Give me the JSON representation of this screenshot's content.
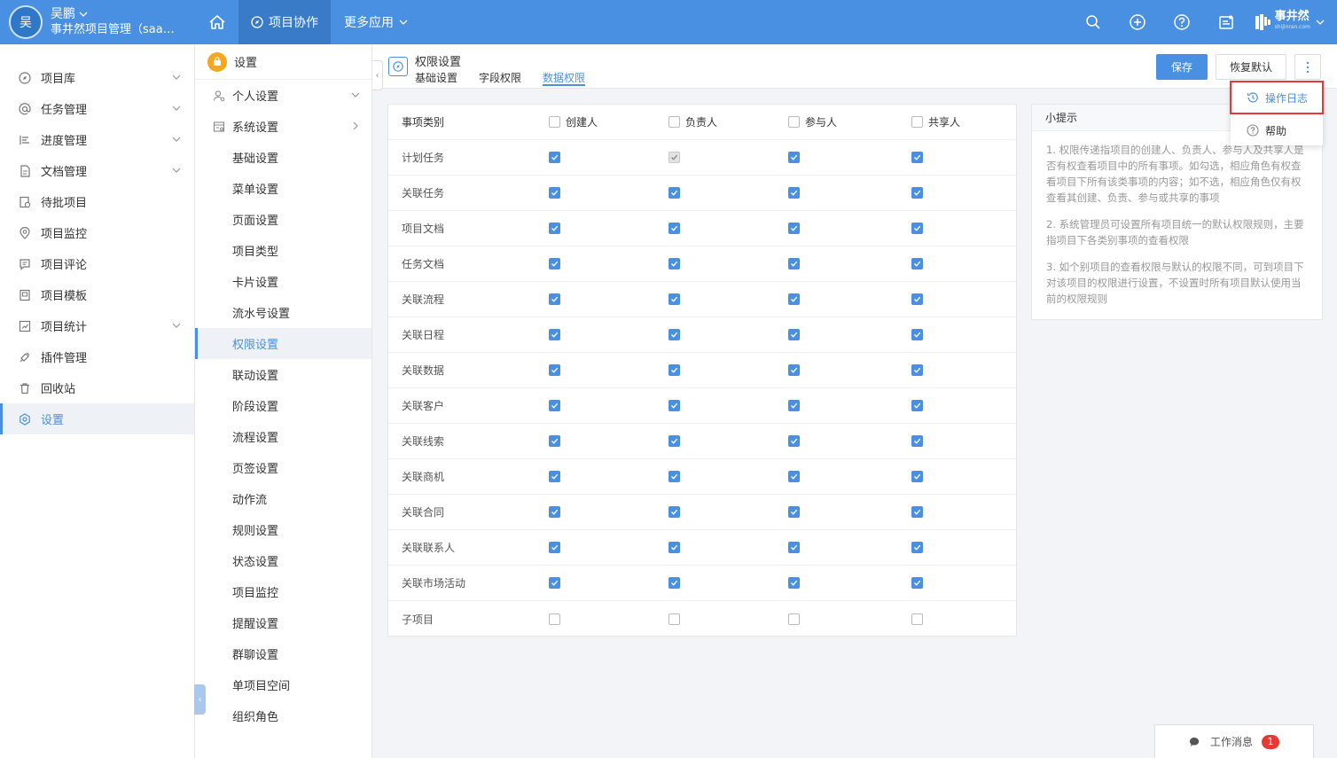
{
  "user": {
    "avatar_text": "吴",
    "name": "吴鹏",
    "org": "事井然项目管理（saas..."
  },
  "topnav": {
    "project_collab": "项目协作",
    "more_apps": "更多应用"
  },
  "brand": {
    "name": "事井然",
    "sub": "shijinran.com"
  },
  "sidebar": {
    "items": [
      {
        "label": "项目库"
      },
      {
        "label": "任务管理"
      },
      {
        "label": "进度管理"
      },
      {
        "label": "文档管理"
      },
      {
        "label": "待批项目"
      },
      {
        "label": "项目监控"
      },
      {
        "label": "项目评论"
      },
      {
        "label": "项目模板"
      },
      {
        "label": "项目统计"
      },
      {
        "label": "插件管理"
      },
      {
        "label": "回收站"
      },
      {
        "label": "设置"
      }
    ]
  },
  "submenu": {
    "title": "设置",
    "personal": "个人设置",
    "system": "系统设置",
    "items": [
      "基础设置",
      "菜单设置",
      "页面设置",
      "项目类型",
      "卡片设置",
      "流水号设置",
      "权限设置",
      "联动设置",
      "阶段设置",
      "流程设置",
      "页签设置",
      "动作流",
      "规则设置",
      "状态设置",
      "项目监控",
      "提醒设置",
      "群聊设置",
      "单项目空间",
      "组织角色"
    ]
  },
  "header": {
    "title": "权限设置",
    "tabs": [
      "基础设置",
      "字段权限",
      "数据权限"
    ],
    "save": "保存",
    "reset": "恢复默认"
  },
  "table": {
    "header": {
      "label": "事项类别",
      "cols": [
        "创建人",
        "负责人",
        "参与人",
        "共享人"
      ]
    },
    "rows": [
      {
        "label": "计划任务",
        "checks": [
          "on",
          "disabled",
          "on",
          "on"
        ]
      },
      {
        "label": "关联任务",
        "checks": [
          "on",
          "on",
          "on",
          "on"
        ]
      },
      {
        "label": "项目文档",
        "checks": [
          "on",
          "on",
          "on",
          "on"
        ]
      },
      {
        "label": "任务文档",
        "checks": [
          "on",
          "on",
          "on",
          "on"
        ]
      },
      {
        "label": "关联流程",
        "checks": [
          "on",
          "on",
          "on",
          "on"
        ]
      },
      {
        "label": "关联日程",
        "checks": [
          "on",
          "on",
          "on",
          "on"
        ]
      },
      {
        "label": "关联数据",
        "checks": [
          "on",
          "on",
          "on",
          "on"
        ]
      },
      {
        "label": "关联客户",
        "checks": [
          "on",
          "on",
          "on",
          "on"
        ]
      },
      {
        "label": "关联线索",
        "checks": [
          "on",
          "on",
          "on",
          "on"
        ]
      },
      {
        "label": "关联商机",
        "checks": [
          "on",
          "on",
          "on",
          "on"
        ]
      },
      {
        "label": "关联合同",
        "checks": [
          "on",
          "on",
          "on",
          "on"
        ]
      },
      {
        "label": "关联联系人",
        "checks": [
          "on",
          "on",
          "on",
          "on"
        ]
      },
      {
        "label": "关联市场活动",
        "checks": [
          "on",
          "on",
          "on",
          "on"
        ]
      },
      {
        "label": "子项目",
        "checks": [
          "off",
          "off",
          "off",
          "off"
        ]
      }
    ]
  },
  "tips": {
    "title": "小提示",
    "items": [
      "1. 权限传递指项目的创建人、负责人、参与人及共享人是否有权查看项目中的所有事项。如勾选，相应角色有权查看项目下所有该类事项的内容；如不选，相应角色仅有权查看其创建、负责、参与或共享的事项",
      "2. 系统管理员可设置所有项目统一的默认权限规则，主要指项目下各类别事项的查看权限",
      "3. 如个别项目的查看权限与默认的权限不同，可到项目下对该项目的权限进行设置，不设置时所有项目默认使用当前的权限规则"
    ]
  },
  "dropdown": {
    "log": "操作日志",
    "help": "帮助"
  },
  "messages": {
    "label": "工作消息",
    "count": "1"
  },
  "colors": {
    "primary": "#4a90e2",
    "danger": "#e53935",
    "warning": "#f5a623"
  }
}
